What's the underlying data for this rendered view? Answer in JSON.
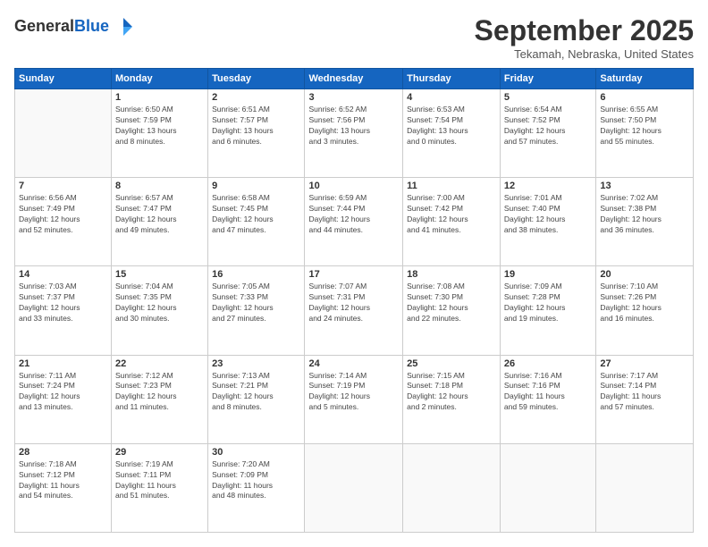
{
  "header": {
    "logo_line1": "General",
    "logo_line2": "Blue",
    "month": "September 2025",
    "location": "Tekamah, Nebraska, United States"
  },
  "days_of_week": [
    "Sunday",
    "Monday",
    "Tuesday",
    "Wednesday",
    "Thursday",
    "Friday",
    "Saturday"
  ],
  "weeks": [
    [
      {
        "day": "",
        "info": ""
      },
      {
        "day": "1",
        "info": "Sunrise: 6:50 AM\nSunset: 7:59 PM\nDaylight: 13 hours\nand 8 minutes."
      },
      {
        "day": "2",
        "info": "Sunrise: 6:51 AM\nSunset: 7:57 PM\nDaylight: 13 hours\nand 6 minutes."
      },
      {
        "day": "3",
        "info": "Sunrise: 6:52 AM\nSunset: 7:56 PM\nDaylight: 13 hours\nand 3 minutes."
      },
      {
        "day": "4",
        "info": "Sunrise: 6:53 AM\nSunset: 7:54 PM\nDaylight: 13 hours\nand 0 minutes."
      },
      {
        "day": "5",
        "info": "Sunrise: 6:54 AM\nSunset: 7:52 PM\nDaylight: 12 hours\nand 57 minutes."
      },
      {
        "day": "6",
        "info": "Sunrise: 6:55 AM\nSunset: 7:50 PM\nDaylight: 12 hours\nand 55 minutes."
      }
    ],
    [
      {
        "day": "7",
        "info": "Sunrise: 6:56 AM\nSunset: 7:49 PM\nDaylight: 12 hours\nand 52 minutes."
      },
      {
        "day": "8",
        "info": "Sunrise: 6:57 AM\nSunset: 7:47 PM\nDaylight: 12 hours\nand 49 minutes."
      },
      {
        "day": "9",
        "info": "Sunrise: 6:58 AM\nSunset: 7:45 PM\nDaylight: 12 hours\nand 47 minutes."
      },
      {
        "day": "10",
        "info": "Sunrise: 6:59 AM\nSunset: 7:44 PM\nDaylight: 12 hours\nand 44 minutes."
      },
      {
        "day": "11",
        "info": "Sunrise: 7:00 AM\nSunset: 7:42 PM\nDaylight: 12 hours\nand 41 minutes."
      },
      {
        "day": "12",
        "info": "Sunrise: 7:01 AM\nSunset: 7:40 PM\nDaylight: 12 hours\nand 38 minutes."
      },
      {
        "day": "13",
        "info": "Sunrise: 7:02 AM\nSunset: 7:38 PM\nDaylight: 12 hours\nand 36 minutes."
      }
    ],
    [
      {
        "day": "14",
        "info": "Sunrise: 7:03 AM\nSunset: 7:37 PM\nDaylight: 12 hours\nand 33 minutes."
      },
      {
        "day": "15",
        "info": "Sunrise: 7:04 AM\nSunset: 7:35 PM\nDaylight: 12 hours\nand 30 minutes."
      },
      {
        "day": "16",
        "info": "Sunrise: 7:05 AM\nSunset: 7:33 PM\nDaylight: 12 hours\nand 27 minutes."
      },
      {
        "day": "17",
        "info": "Sunrise: 7:07 AM\nSunset: 7:31 PM\nDaylight: 12 hours\nand 24 minutes."
      },
      {
        "day": "18",
        "info": "Sunrise: 7:08 AM\nSunset: 7:30 PM\nDaylight: 12 hours\nand 22 minutes."
      },
      {
        "day": "19",
        "info": "Sunrise: 7:09 AM\nSunset: 7:28 PM\nDaylight: 12 hours\nand 19 minutes."
      },
      {
        "day": "20",
        "info": "Sunrise: 7:10 AM\nSunset: 7:26 PM\nDaylight: 12 hours\nand 16 minutes."
      }
    ],
    [
      {
        "day": "21",
        "info": "Sunrise: 7:11 AM\nSunset: 7:24 PM\nDaylight: 12 hours\nand 13 minutes."
      },
      {
        "day": "22",
        "info": "Sunrise: 7:12 AM\nSunset: 7:23 PM\nDaylight: 12 hours\nand 11 minutes."
      },
      {
        "day": "23",
        "info": "Sunrise: 7:13 AM\nSunset: 7:21 PM\nDaylight: 12 hours\nand 8 minutes."
      },
      {
        "day": "24",
        "info": "Sunrise: 7:14 AM\nSunset: 7:19 PM\nDaylight: 12 hours\nand 5 minutes."
      },
      {
        "day": "25",
        "info": "Sunrise: 7:15 AM\nSunset: 7:18 PM\nDaylight: 12 hours\nand 2 minutes."
      },
      {
        "day": "26",
        "info": "Sunrise: 7:16 AM\nSunset: 7:16 PM\nDaylight: 11 hours\nand 59 minutes."
      },
      {
        "day": "27",
        "info": "Sunrise: 7:17 AM\nSunset: 7:14 PM\nDaylight: 11 hours\nand 57 minutes."
      }
    ],
    [
      {
        "day": "28",
        "info": "Sunrise: 7:18 AM\nSunset: 7:12 PM\nDaylight: 11 hours\nand 54 minutes."
      },
      {
        "day": "29",
        "info": "Sunrise: 7:19 AM\nSunset: 7:11 PM\nDaylight: 11 hours\nand 51 minutes."
      },
      {
        "day": "30",
        "info": "Sunrise: 7:20 AM\nSunset: 7:09 PM\nDaylight: 11 hours\nand 48 minutes."
      },
      {
        "day": "",
        "info": ""
      },
      {
        "day": "",
        "info": ""
      },
      {
        "day": "",
        "info": ""
      },
      {
        "day": "",
        "info": ""
      }
    ]
  ]
}
